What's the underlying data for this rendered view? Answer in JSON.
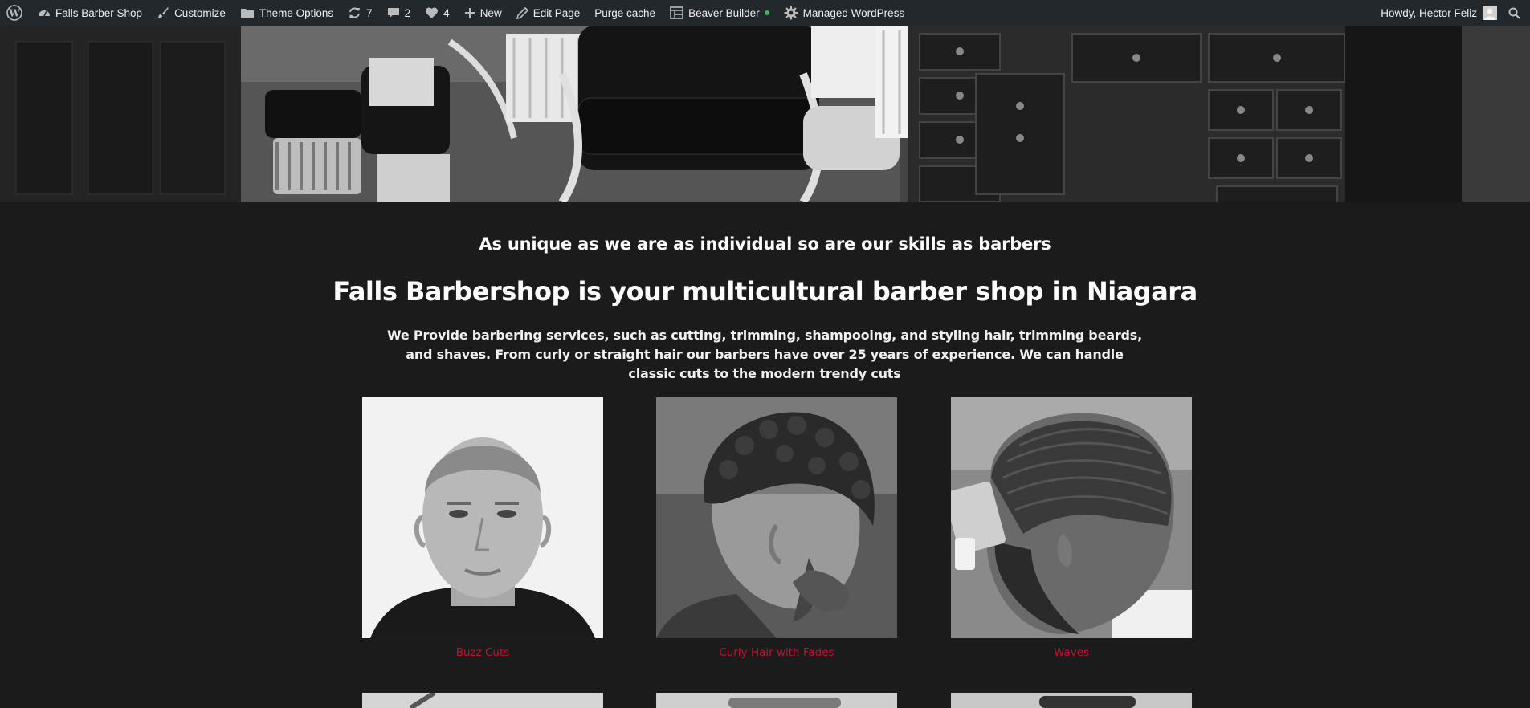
{
  "admin_bar": {
    "site_name": "Falls Barber Shop",
    "customize": "Customize",
    "theme_options": "Theme Options",
    "updates_count": "7",
    "comments_count": "2",
    "likes_count": "4",
    "new": "New",
    "edit_page": "Edit Page",
    "purge_cache": "Purge cache",
    "beaver_builder": "Beaver Builder",
    "managed_wordpress": "Managed WordPress",
    "howdy": "Howdy, Hector Feliz"
  },
  "content": {
    "tagline": "As unique as we are as individual so are our skills as barbers",
    "headline": "Falls Barbershop is your multicultural barber shop in Niagara",
    "description": "We Provide barbering services, such as cutting, trimming, shampooing, and styling hair, trimming beards, and shaves. From curly or straight hair our barbers have over 25 years of experience. We can handle classic cuts to the modern trendy cuts"
  },
  "gallery": [
    {
      "caption": "Buzz Cuts"
    },
    {
      "caption": "Curly Hair with Fades"
    },
    {
      "caption": "Waves"
    }
  ],
  "colors": {
    "admin_bar_bg": "#23282d",
    "page_bg": "#1b1b1b",
    "caption_red": "#c8102e",
    "status_green": "#46b450"
  }
}
